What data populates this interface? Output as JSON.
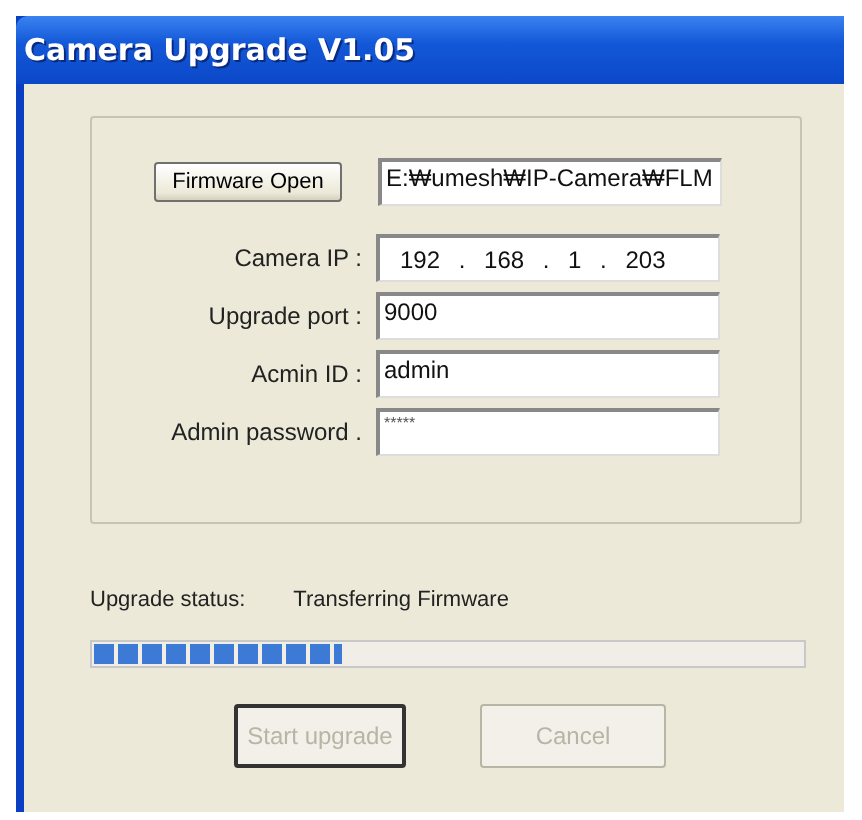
{
  "window": {
    "title": "Camera Upgrade V1.05"
  },
  "firmware_button": {
    "label": "Firmware Open"
  },
  "firmware_path": {
    "value": "E:₩umesh₩IP-Camera₩FLM"
  },
  "fields": [
    {
      "kind": "ip",
      "label": "Camera IP :",
      "value": "192 . 168 . 1 . 203"
    },
    {
      "kind": "text",
      "label": "Upgrade port :",
      "value": "9000"
    },
    {
      "kind": "text",
      "label": "Acmin ID :",
      "value": "admin"
    },
    {
      "kind": "password",
      "label": "Admin password .",
      "value": "*****"
    }
  ],
  "status": {
    "label": "Upgrade status:",
    "value": "Transferring Firmware"
  },
  "progress": {
    "level": 0.35
  },
  "buttons": [
    {
      "label": "Start upgrade",
      "disabled": true,
      "default": true
    },
    {
      "label": "Cancel",
      "disabled": true,
      "default": false
    }
  ]
}
